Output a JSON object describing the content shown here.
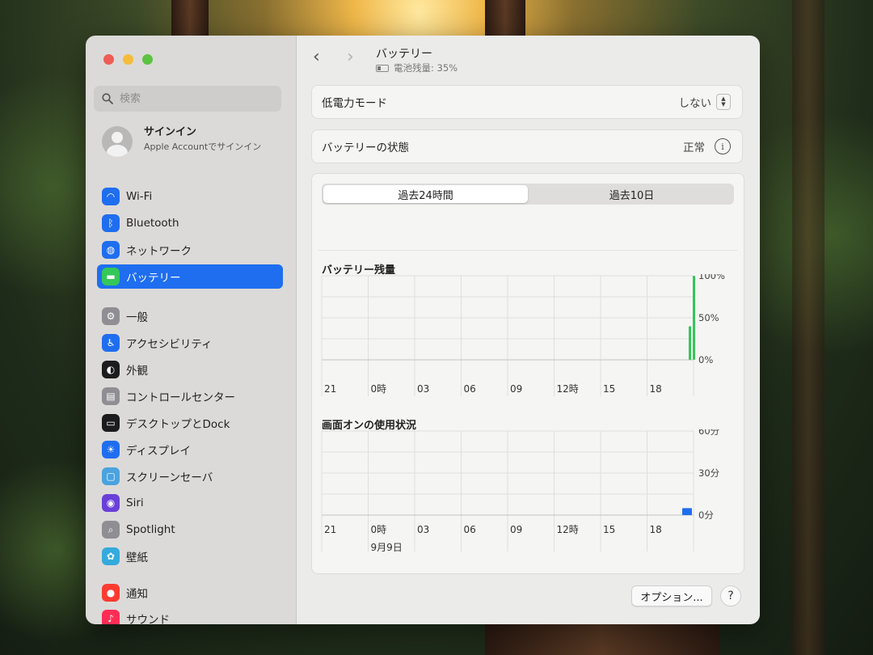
{
  "window": {
    "title": "バッテリー",
    "battery_status": "電池残量: 35%"
  },
  "sidebar": {
    "search_placeholder": "検索",
    "account": {
      "title": "サインイン",
      "subtitle": "Apple Accountでサインイン"
    },
    "items": [
      {
        "label": "Wi-Fi",
        "icon": "wifi-icon",
        "color": "#1f6ef0"
      },
      {
        "label": "Bluetooth",
        "icon": "bluetooth-icon",
        "color": "#1f6ef0"
      },
      {
        "label": "ネットワーク",
        "icon": "globe-icon",
        "color": "#1f6ef0"
      },
      {
        "label": "バッテリー",
        "icon": "battery-icon",
        "color": "#34c759"
      },
      {
        "label": "一般",
        "icon": "gear-icon",
        "color": "#8e8e93"
      },
      {
        "label": "アクセシビリティ",
        "icon": "accessibility-icon",
        "color": "#1f6ef0"
      },
      {
        "label": "外観",
        "icon": "appearance-icon",
        "color": "#1c1c1e"
      },
      {
        "label": "コントロールセンター",
        "icon": "control-center-icon",
        "color": "#8e8e93"
      },
      {
        "label": "デスクトップとDock",
        "icon": "desktop-dock-icon",
        "color": "#1c1c1e"
      },
      {
        "label": "ディスプレイ",
        "icon": "display-icon",
        "color": "#1f6ef0"
      },
      {
        "label": "スクリーンセーバ",
        "icon": "screensaver-icon",
        "color": "#4aa3df"
      },
      {
        "label": "Siri",
        "icon": "siri-icon",
        "color": "#6a3fd9"
      },
      {
        "label": "Spotlight",
        "icon": "spotlight-icon",
        "color": "#8e8e93"
      },
      {
        "label": "壁紙",
        "icon": "wallpaper-icon",
        "color": "#34aadc"
      },
      {
        "label": "通知",
        "icon": "notification-icon",
        "color": "#ff3b30"
      },
      {
        "label": "サウンド",
        "icon": "sound-icon",
        "color": "#ff2d55"
      }
    ]
  },
  "settings": {
    "low_power": {
      "label": "低電力モード",
      "value": "しない"
    },
    "health": {
      "label": "バッテリーの状態",
      "value": "正常"
    }
  },
  "tabs": [
    {
      "label": "過去24時間",
      "active": true
    },
    {
      "label": "過去10日",
      "active": false
    }
  ],
  "chart_data": [
    {
      "type": "bar",
      "title": "バッテリー残量",
      "x_ticks": [
        "21",
        "0時",
        "03",
        "06",
        "09",
        "12時",
        "15",
        "18"
      ],
      "y_ticks": [
        "100%",
        "50%",
        "0%"
      ],
      "ylim": [
        0,
        100
      ],
      "series": [
        {
          "values": [
            40,
            100
          ],
          "color": "#34c759"
        }
      ]
    },
    {
      "type": "bar",
      "title": "画面オンの使用状況",
      "x_ticks": [
        "21",
        "0時",
        "03",
        "06",
        "09",
        "12時",
        "15",
        "18"
      ],
      "x_sublabel": "9月9日",
      "y_ticks": [
        "60分",
        "30分",
        "0分"
      ],
      "ylim": [
        0,
        60
      ],
      "series": [
        {
          "values": [
            5
          ],
          "color": "#1f6ef0"
        }
      ]
    }
  ],
  "footer": {
    "options_label": "オプション...",
    "help_label": "?"
  }
}
